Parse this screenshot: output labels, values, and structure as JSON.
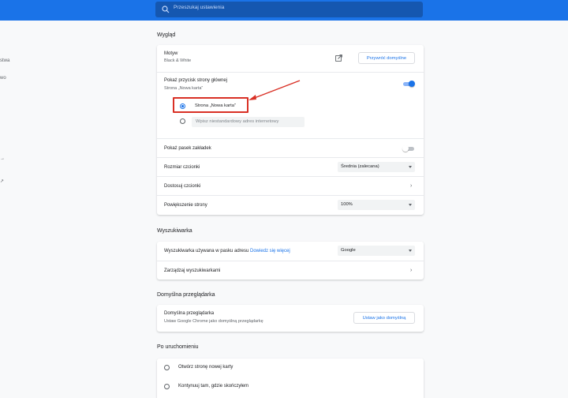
{
  "search": {
    "placeholder": "Przeszukaj ustawienia"
  },
  "leftnav": {
    "items": [
      "stwa",
      "wo",
      "→",
      "↗"
    ]
  },
  "appearance": {
    "title": "Wygląd",
    "theme_label": "Motyw",
    "theme_value": "Black & White",
    "reset_button": "Przywróć domyślne",
    "home_button_label": "Pokaż przycisk strony głównej",
    "home_button_sub": "Strona „Nowa karta”",
    "home_button_enabled": true,
    "radio_newtab_label": "Strona „Nowa karta”",
    "custom_url_placeholder": "Wpisz niestandardowy adres internetowy",
    "bookmarks_bar_label": "Pokaż pasek zakładek",
    "bookmarks_bar_enabled": false,
    "font_size_label": "Rozmiar czcionki",
    "font_size_value": "Średnia (zalecana)",
    "customize_fonts_label": "Dostosuj czcionki",
    "zoom_label": "Powiększenie strony",
    "zoom_value": "100%"
  },
  "search_engine": {
    "title": "Wyszukiwarka",
    "engine_label": "Wyszukiwarka używana w pasku adresu",
    "learn_more": "Dowiedz się więcej",
    "engine_value": "Google",
    "manage_label": "Zarządzaj wyszukiwarkami"
  },
  "default_browser": {
    "title": "Domyślna przeglądarka",
    "label": "Domyślna przeglądarka",
    "sub": "Ustaw Google Chrome jako domyślną przeglądarkę",
    "button": "Ustaw jako domyślną"
  },
  "startup": {
    "title": "Po uruchomieniu",
    "option1": "Otwórz stronę nowej karty",
    "option2": "Kontynuuj tam, gdzie skończyłem"
  },
  "colors": {
    "accent": "#1a73e8",
    "topbar": "#1a73e8",
    "annotation": "#d93025"
  }
}
